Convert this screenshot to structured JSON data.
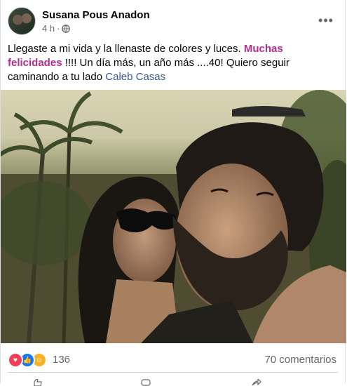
{
  "post": {
    "author": "Susana Pous Anadon",
    "time": "4 h",
    "separator": "·",
    "text_part1": "Llegaste a mi vida y la llenaste de colores y luces. ",
    "highlight": "Muchas felicidades",
    "text_part2": " !!!! Un día más, un año más ....40! Quiero seguir caminando a tu lado ",
    "mention": "Caleb Casas",
    "more_label": "•••"
  },
  "footer": {
    "reaction_count": "136",
    "comments": "70 comentarios",
    "reactions": [
      "love-icon",
      "like-icon",
      "care-icon"
    ]
  },
  "colors": {
    "highlight": "#b22e8d",
    "mention": "#385898",
    "secondary_text": "#65676b"
  }
}
